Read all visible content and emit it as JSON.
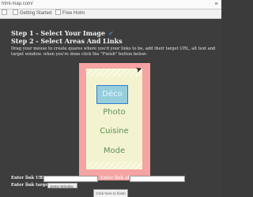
{
  "browser": {
    "url": "html-map.com/",
    "bookmark": "Getting Started",
    "bookmark2": "Free Hotm"
  },
  "step1": {
    "label": "Step 1 - Select Your Image",
    "check": "✔"
  },
  "step2": {
    "label": "Step 2 - Select Areas And Links",
    "instructions": "Drag your mouse to create quares where you'd your links to be, add their target URL, alt text and target window. when you're done click the \"Finish\" button below:"
  },
  "image": {
    "words": [
      "Déco",
      "Photo",
      "Cuisine",
      "Mode"
    ],
    "selected_word": "Déco"
  },
  "form": {
    "link_url_label": "Enter link URL:",
    "link_alt_label": "Enter link alt:",
    "link_target_label": "Enter link target:",
    "link_target_value": "Same Window"
  },
  "finish_label": "Click here to finish"
}
